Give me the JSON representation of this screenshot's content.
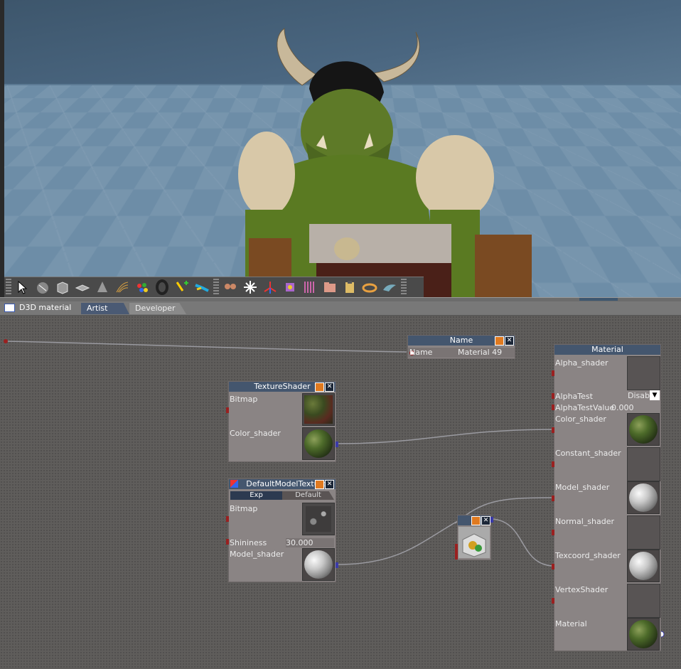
{
  "toolbar": {
    "tools": [
      "select-tool-icon",
      "sphere-tool-icon",
      "box-tool-icon",
      "plane-tool-icon",
      "cone-tool-icon",
      "hair-tool-icon",
      "particles-tool-icon",
      "torus-tool-icon",
      "bone-add-tool-icon",
      "ribbon-tool-icon",
      "figures-tool-icon",
      "light-tool-icon",
      "axes-tool-icon",
      "cube-tool-icon",
      "curtain-tool-icon",
      "folder-tool-icon",
      "clipboard-tool-icon",
      "ring-tool-icon",
      "dolphin-tool-icon"
    ]
  },
  "panel": {
    "title": "D3D material",
    "tabs": [
      {
        "label": "Artist"
      },
      {
        "label": "Developer"
      }
    ]
  },
  "nodes": {
    "name": {
      "title": "Name",
      "field_label": "Name",
      "field_value": "Material  49"
    },
    "texture_shader": {
      "title": "TextureShader",
      "bitmap_label": "Bitmap",
      "color_shader_label": "Color_shader"
    },
    "default_model_texture": {
      "title": "DefaultModelTexture",
      "tabs": [
        "Exp",
        "Default"
      ],
      "bitmap_label": "Bitmap",
      "shininess_label": "Shininess",
      "shininess_value": "30.000",
      "model_shader_label": "Model_shader"
    },
    "material": {
      "title": "Material",
      "alpha_shader_label": "Alpha_shader",
      "alpha_test_label": "AlphaTest",
      "alpha_test_value": "Disabl",
      "alpha_test_value_label": "AlphaTestValue",
      "alpha_test_value_value": "0.000",
      "color_shader_label": "Color_shader",
      "constant_shader_label": "Constant_shader",
      "model_shader_label": "Model_shader",
      "normal_shader_label": "Normal_shader",
      "texcoord_shader_label": "Texcoord_shader",
      "vertex_shader_label": "VertexShader",
      "material_label": "Material"
    }
  },
  "colors": {
    "node_header": "#44566e",
    "node_body": "#8a8484",
    "close_orange": "#e07a20",
    "wire": "#9a9aa0",
    "input_port": "#9a2020",
    "output_port": "#3a3aa8"
  }
}
